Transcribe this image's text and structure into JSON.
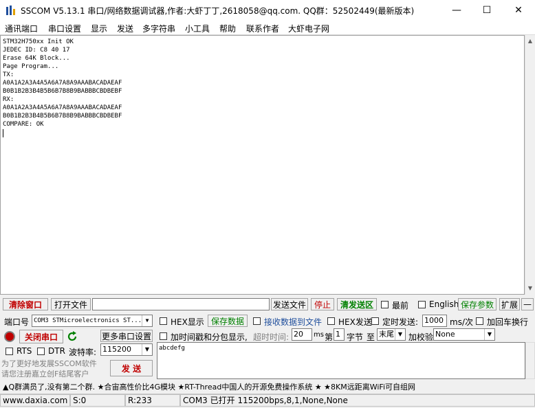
{
  "window": {
    "title": "SSCOM V5.13.1 串口/网络数据调试器,作者:大虾丁丁,2618058@qq.com. QQ群：52502449(最新版本)",
    "minimize": "—",
    "maximize": "☐",
    "close": "✕"
  },
  "menu": [
    "通讯端口",
    "串口设置",
    "显示",
    "发送",
    "多字符串",
    "小工具",
    "帮助",
    "联系作者",
    "大虾电子网"
  ],
  "receive_lines": [
    "STM32H750xx Init OK",
    "JEDEC ID: C8 40 17",
    "Erase 64K Block...",
    "Page Program...",
    "TX:",
    "A0A1A2A3A4A5A6A7A8A9AAABACADAEAF",
    "B0B1B2B3B4B5B6B7B8B9BABBBCBDBEBF",
    "RX:",
    "A0A1A2A3A4A5A6A7A8A9AAABACADAEAF",
    "B0B1B2B3B4B5B6B7B8B9BABBBCBDBEBF",
    "COMPARE: OK"
  ],
  "row1": {
    "clear_window": "清除窗口",
    "open_file": "打开文件",
    "send_file": "发送文件",
    "stop": "停止",
    "clear_send": "清发送区",
    "topmost": "最前",
    "english": "English",
    "save_params": "保存参数",
    "expand": "扩展",
    "minus": "—"
  },
  "row2": {
    "port_label": "端口号",
    "port_value": "COM3 STMicroelectronics ST...",
    "hex_display": "HEX显示",
    "save_data": "保存数据",
    "recv_to_file": "接收数据到文件",
    "hex_send": "HEX发送",
    "timed_send": "定时发送:",
    "interval": "1000",
    "interval_unit": "ms/次",
    "add_crlf": "加回车换行"
  },
  "row3": {
    "close_port": "关闭串口",
    "more_settings": "更多串口设置",
    "timestamp": "加时间戳和分包显示,",
    "timeout_label": "超时时间:",
    "timeout_value": "20",
    "timeout_unit": "ms",
    "nth_label": "第",
    "nth_value": "1",
    "byte_label": "字节",
    "to_label": "至",
    "end_value": "末尾",
    "checksum_label": "加校验",
    "checksum_value": "None"
  },
  "row4": {
    "rts": "RTS",
    "dtr": "DTR",
    "baud_label": "波特率:",
    "baud_value": "115200"
  },
  "send": {
    "text": "abcdefg",
    "button": "发 送",
    "promo_line1": "为了更好地发展SSCOM软件",
    "promo_line2": "请您注册嘉立创F结尾客户"
  },
  "ticker": "▲Q群满员了,没有第二个群. ★合宙高性价比4G模块 ★RT-Thread中国人的开源免费操作系统 ★ ★8KM远距离WiFi可自组网",
  "status": {
    "website": "www.daxia.com",
    "sent": "S:0",
    "received": "R:233",
    "port_info": "COM3 已打开  115200bps,8,1,None,None"
  },
  "colors": {
    "accent_red": "#c00000",
    "accent_green": "#008000",
    "app_icon_blue": "#1f4e9c"
  }
}
